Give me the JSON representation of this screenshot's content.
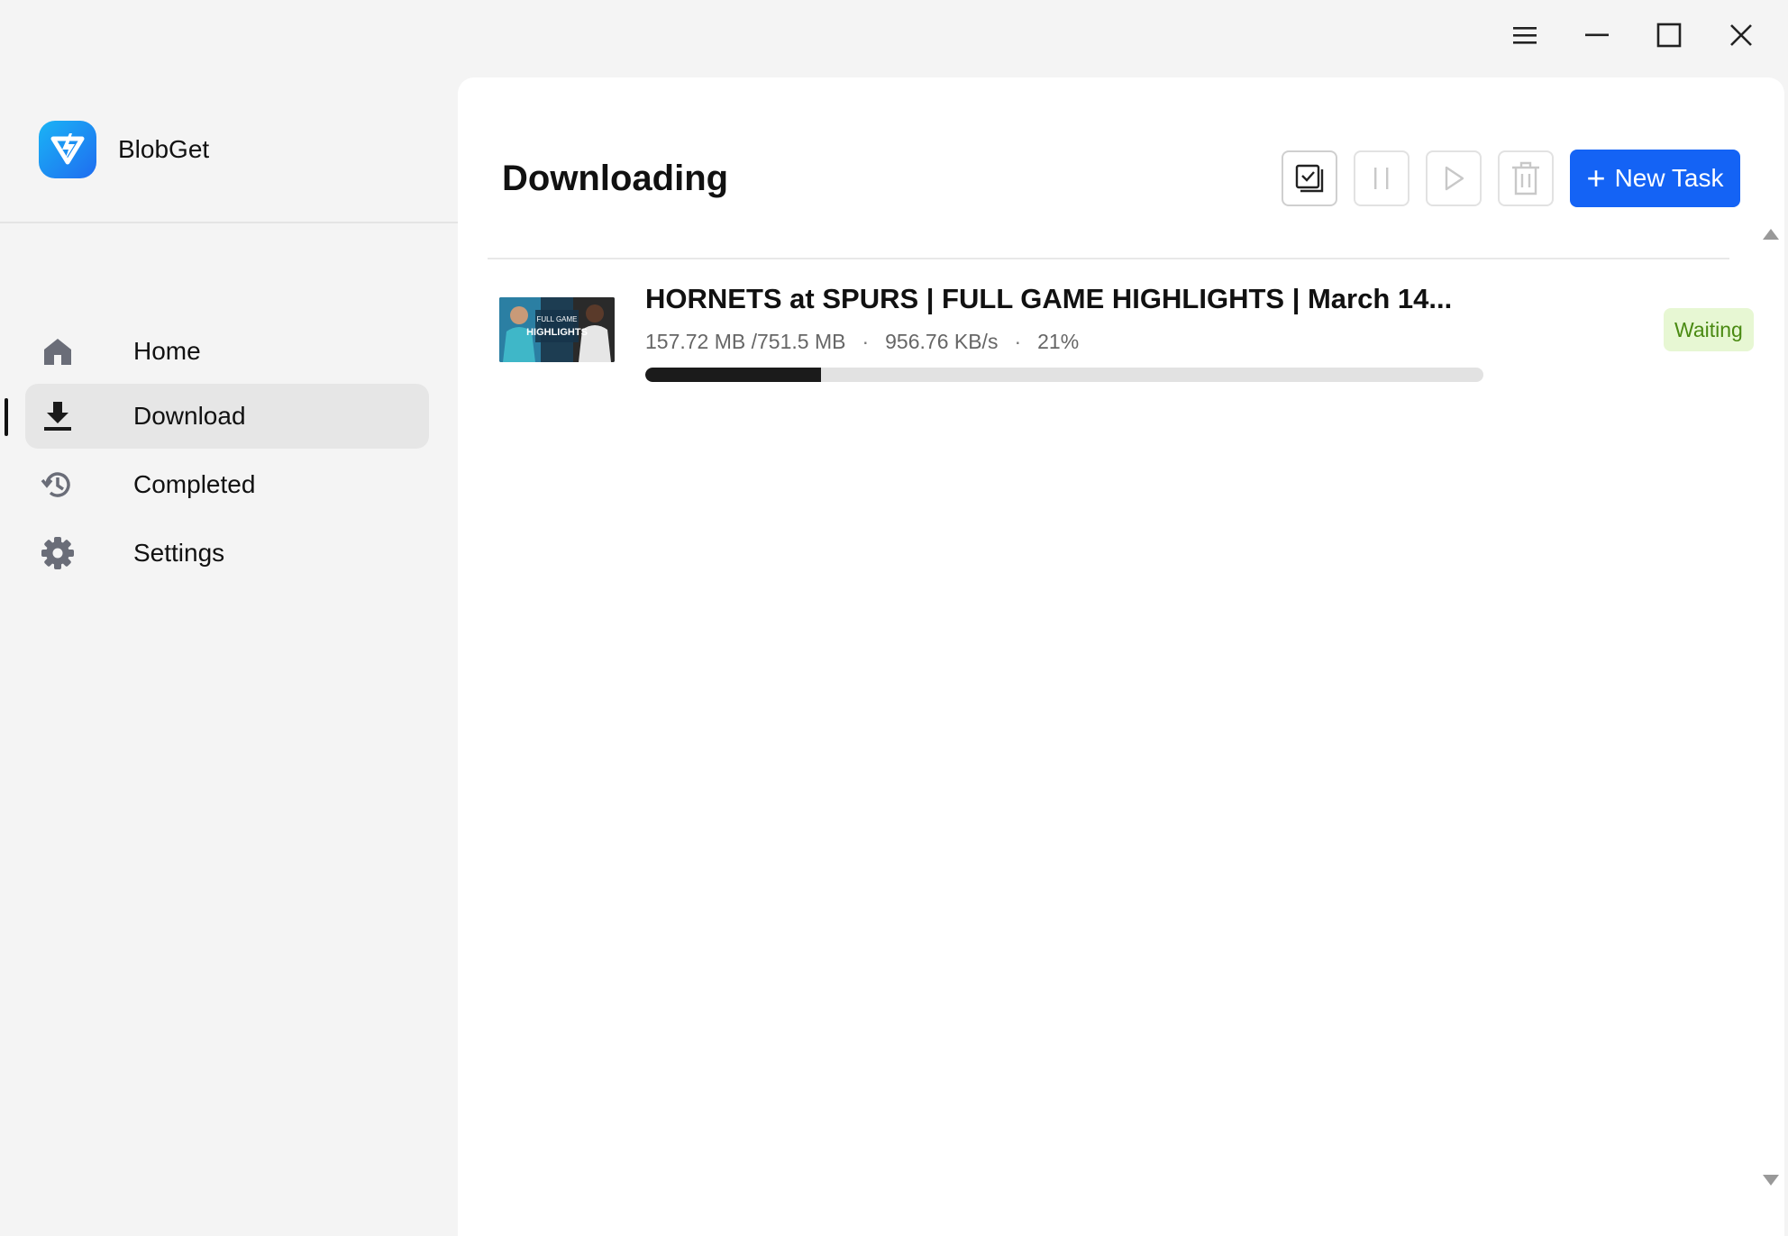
{
  "app": {
    "name": "BlobGet",
    "brand_color": "#1f6cf0"
  },
  "window_controls": {
    "menu_icon": "hamburger-menu-icon",
    "minimize_icon": "minimize-icon",
    "maximize_icon": "maximize-icon",
    "close_icon": "close-icon"
  },
  "sidebar": {
    "items": [
      {
        "label": "Home",
        "icon": "home-icon",
        "active": false
      },
      {
        "label": "Download",
        "icon": "download-icon",
        "active": true
      },
      {
        "label": "Completed",
        "icon": "history-icon",
        "active": false
      },
      {
        "label": "Settings",
        "icon": "gear-icon",
        "active": false
      }
    ]
  },
  "main": {
    "title": "Downloading",
    "toolbar": {
      "select_icon": "select-all-icon",
      "pause_icon": "pause-icon",
      "resume_icon": "play-icon",
      "delete_icon": "trash-icon",
      "new_task_label": "New Task",
      "new_task_color": "#1463f5"
    },
    "tasks": [
      {
        "title": "HORNETS at SPURS | FULL GAME HIGHLIGHTS | March 14...",
        "thumbnail_text_1": "FULL GAME",
        "thumbnail_text_2": "HIGHLIGHTS",
        "size": "157.72 MB /751.5 MB",
        "speed": "956.76 KB/s",
        "percent": "21%",
        "progress": 0.21,
        "status": "Waiting",
        "status_color": "#4a8a12"
      }
    ]
  }
}
